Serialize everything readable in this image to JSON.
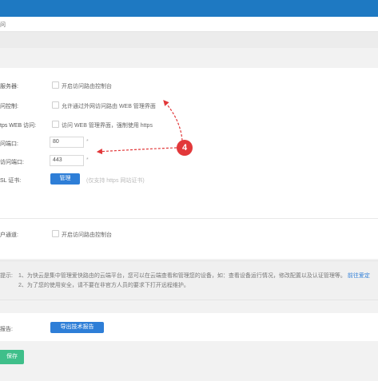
{
  "breadcrumb": "问",
  "remote": {
    "label_server": "服务器:",
    "open_console": "开启访问路由控制台",
    "label_access": "问控制:",
    "allow_web": "允许通过外网访问路由 WEB 管理界面",
    "label_https": "tps WEB 访问:",
    "force_https": "访问 WEB 管理界面，强制使用 https",
    "label_port": "问端口:",
    "port_value": "80",
    "label_https_port": "访问端口:",
    "https_port_value": "443",
    "label_ssl": "SL 证书:",
    "manage_btn": "管理",
    "ssl_hint": "(仅支持 https 网站证书)",
    "required_mark": "*"
  },
  "annotation": {
    "number": "4",
    "color": "#e2383a"
  },
  "channel": {
    "label": "户通道:",
    "open_console": "开启访问路由控制台"
  },
  "tips": {
    "prefix": "提示:",
    "line1": "1、为快云是集中管理爱快路由的云端平台，您可以在云端查看和管理您的设备，如：查看设备运行情况，修改配置以及认证管理等。",
    "line1_link": "前往爱定",
    "line2": "2、为了您的使用安全，请不要在非官方人员的要求下打开远程维护。"
  },
  "report": {
    "label": "报告:",
    "export_btn": "导出技术报告"
  },
  "save_label": "保存",
  "colors": {
    "accent": "#2e7ed7",
    "topbar": "#1e79c2",
    "save": "#3fbf8a"
  }
}
